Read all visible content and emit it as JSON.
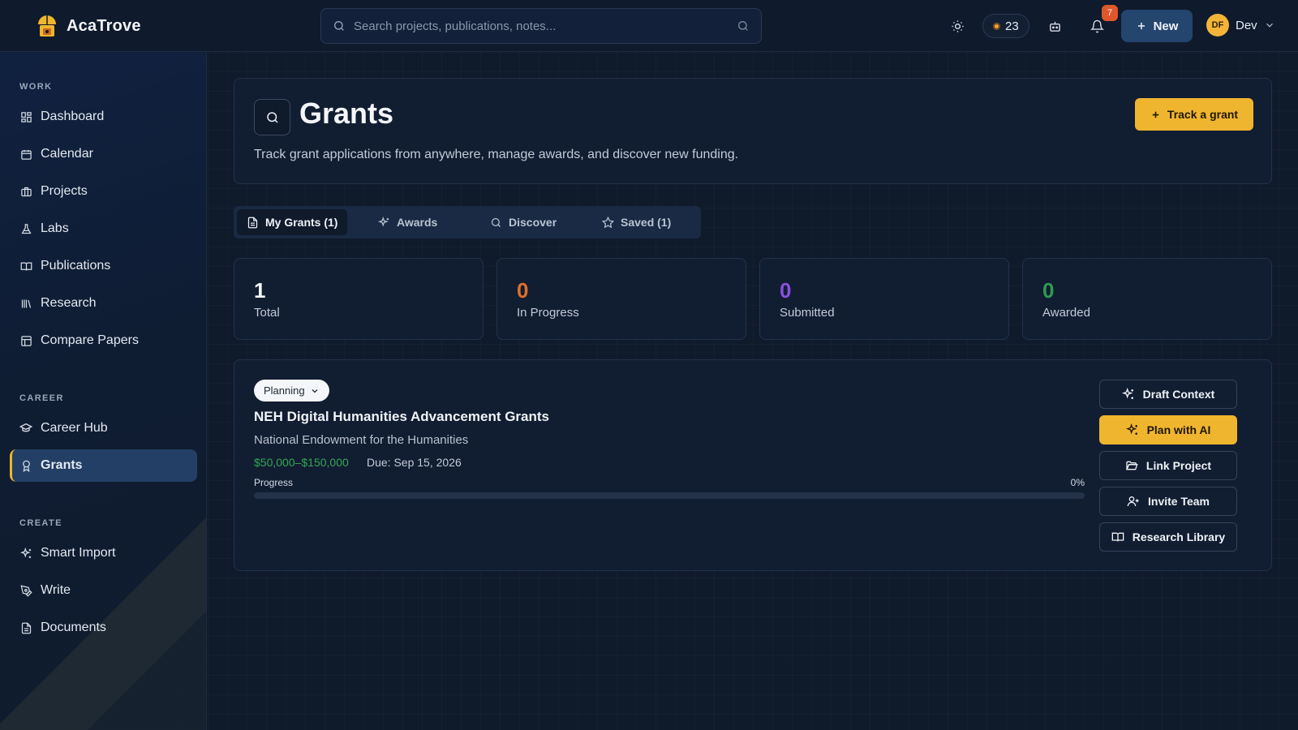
{
  "app": {
    "name": "AcaTrove"
  },
  "colors": {
    "accent": "#f0b52e",
    "in_progress": "#e0702b",
    "submitted": "#8b4fe0",
    "awarded": "#2e9c4e"
  },
  "topbar": {
    "search_placeholder": "Search projects, publications, notes...",
    "coins": "23",
    "notifications_count": "7",
    "new_label": "New",
    "user_initials": "DF",
    "user_name": "Dev"
  },
  "sidebar": {
    "sections": [
      {
        "label": "WORK",
        "items": [
          {
            "label": "Dashboard",
            "icon": "grid-icon"
          },
          {
            "label": "Calendar",
            "icon": "calendar-icon"
          },
          {
            "label": "Projects",
            "icon": "briefcase-icon"
          },
          {
            "label": "Labs",
            "icon": "flask-icon"
          },
          {
            "label": "Publications",
            "icon": "book-open-icon"
          },
          {
            "label": "Research",
            "icon": "library-icon"
          },
          {
            "label": "Compare Papers",
            "icon": "table-icon"
          }
        ]
      },
      {
        "label": "CAREER",
        "items": [
          {
            "label": "Career Hub",
            "icon": "graduation-cap-icon"
          },
          {
            "label": "Grants",
            "icon": "award-icon",
            "active": true
          }
        ]
      },
      {
        "label": "CREATE",
        "items": [
          {
            "label": "Smart Import",
            "icon": "sparkles-icon"
          },
          {
            "label": "Write",
            "icon": "pen-icon"
          },
          {
            "label": "Documents",
            "icon": "document-icon"
          }
        ]
      }
    ]
  },
  "page": {
    "title": "Grants",
    "subtitle": "Track grant applications from anywhere, manage awards, and discover new funding.",
    "track_button": "Track a grant"
  },
  "tabs": [
    {
      "label": "My Grants (1)",
      "icon": "document-icon",
      "active": true
    },
    {
      "label": "Awards",
      "icon": "sparkles-icon"
    },
    {
      "label": "Discover",
      "icon": "search-icon"
    },
    {
      "label": "Saved (1)",
      "icon": "star-icon"
    }
  ],
  "stats": [
    {
      "value": "1",
      "label": "Total"
    },
    {
      "value": "0",
      "label": "In Progress"
    },
    {
      "value": "0",
      "label": "Submitted"
    },
    {
      "value": "0",
      "label": "Awarded"
    }
  ],
  "grant": {
    "status": "Planning",
    "title": "NEH Digital Humanities Advancement Grants",
    "organization": "National Endowment for the Humanities",
    "amount": "$50,000–$150,000",
    "due": "Due: Sep 15, 2026",
    "progress_label": "Progress",
    "progress_text": "0%",
    "progress_fraction": 0,
    "actions": [
      {
        "label": "Draft Context",
        "icon": "sparkles-icon"
      },
      {
        "label": "Plan with AI",
        "icon": "sparkles-icon",
        "primary": true
      },
      {
        "label": "Link Project",
        "icon": "folder-open-icon"
      },
      {
        "label": "Invite Team",
        "icon": "user-plus-icon"
      },
      {
        "label": "Research Library",
        "icon": "book-open-icon"
      }
    ]
  }
}
